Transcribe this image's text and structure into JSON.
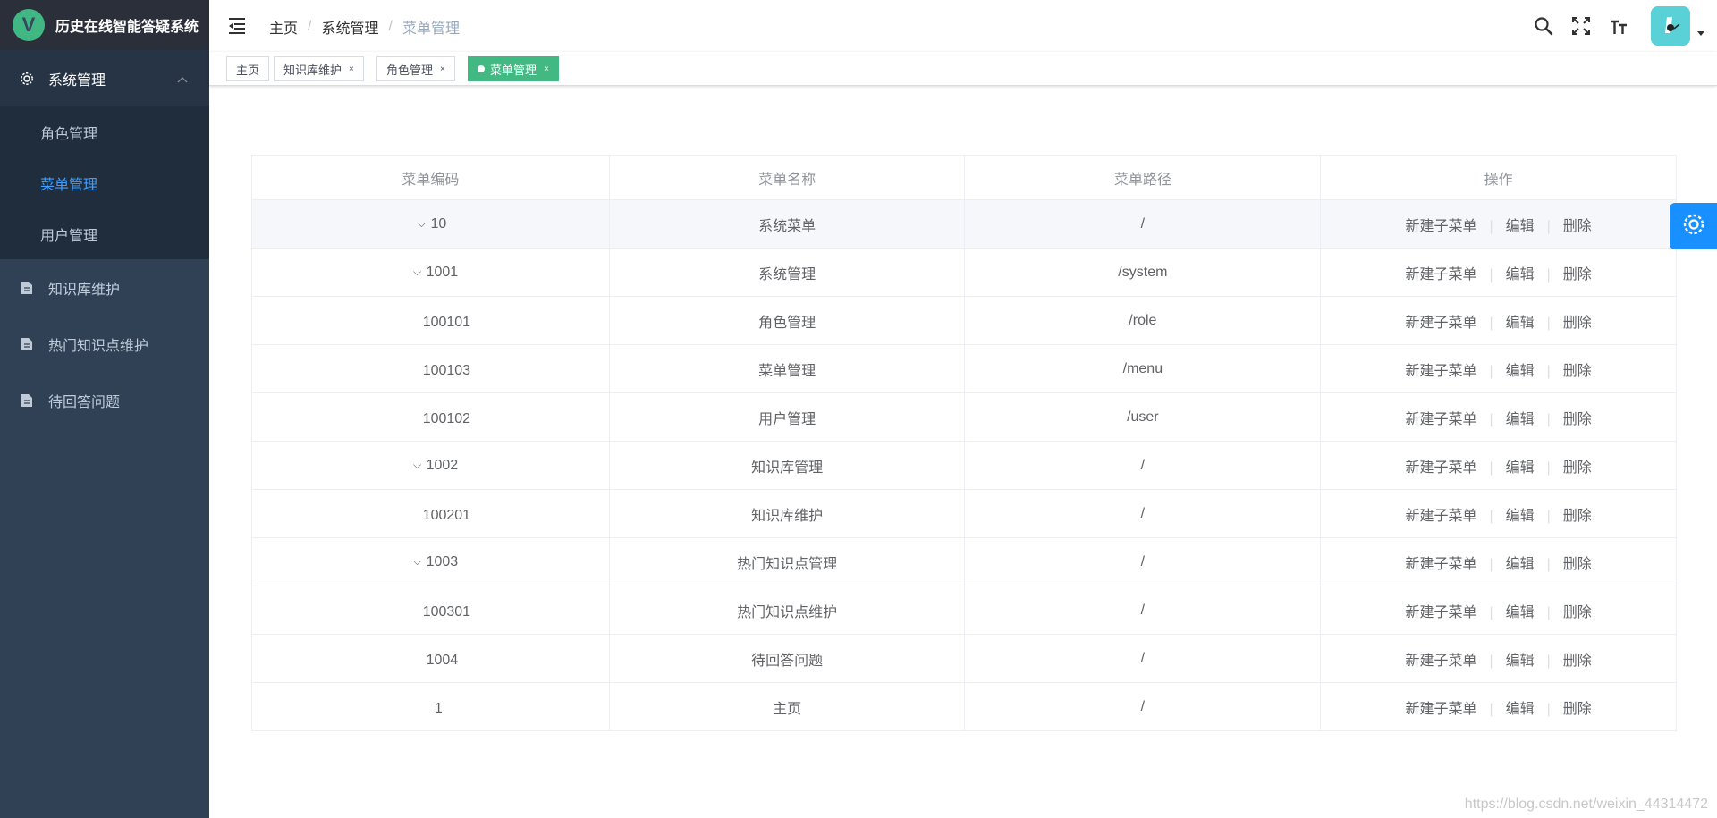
{
  "app": {
    "logo_letter": "V",
    "title": "历史在线智能答疑系统"
  },
  "sidebar": {
    "groups": [
      {
        "label": "系统管理",
        "icon": "gear-icon",
        "open": true,
        "items": [
          {
            "label": "角色管理"
          },
          {
            "label": "菜单管理",
            "active": true
          },
          {
            "label": "用户管理"
          }
        ]
      },
      {
        "label": "知识库维护",
        "icon": "document-icon"
      },
      {
        "label": "热门知识点维护",
        "icon": "document-icon"
      },
      {
        "label": "待回答问题",
        "icon": "document-icon"
      }
    ]
  },
  "navbar": {
    "breadcrumb": [
      "主页",
      "系统管理",
      "菜单管理"
    ]
  },
  "tags": [
    {
      "label": "主页"
    },
    {
      "label": "知识库维护",
      "close": "×"
    },
    {
      "label": "角色管理",
      "close": "×"
    },
    {
      "label": "菜单管理",
      "close": "×",
      "active": true
    }
  ],
  "table": {
    "headers": [
      "菜单编码",
      "菜单名称",
      "菜单路径",
      "操作"
    ],
    "ops": {
      "add": "新建子菜单",
      "edit": "编辑",
      "delete": "删除",
      "separator": "|"
    },
    "rows": [
      {
        "code": "10",
        "name": "系统菜单",
        "path": "/",
        "expand": true,
        "level": 0
      },
      {
        "code": "1001",
        "name": "系统管理",
        "path": "/system",
        "expand": true,
        "level": 1
      },
      {
        "code": "100101",
        "name": "角色管理",
        "path": "/role",
        "level": 2
      },
      {
        "code": "100103",
        "name": "菜单管理",
        "path": "/menu",
        "level": 2
      },
      {
        "code": "100102",
        "name": "用户管理",
        "path": "/user",
        "level": 2
      },
      {
        "code": "1002",
        "name": "知识库管理",
        "path": "/",
        "expand": true,
        "level": 1
      },
      {
        "code": "100201",
        "name": "知识库维护",
        "path": "/",
        "level": 2
      },
      {
        "code": "1003",
        "name": "热门知识点管理",
        "path": "/",
        "expand": true,
        "level": 1
      },
      {
        "code": "100301",
        "name": "热门知识点维护",
        "path": "/",
        "level": 2
      },
      {
        "code": "1004",
        "name": "待回答问题",
        "path": "/",
        "level": 1
      },
      {
        "code": "1",
        "name": "主页",
        "path": "/",
        "level": 0
      }
    ]
  },
  "watermark": "https://blog.csdn.net/weixin_44314472",
  "colors": {
    "sidebar_bg": "#304156",
    "accent": "#409eff",
    "tag_active": "#42b983",
    "settings_btn": "#1890ff"
  }
}
